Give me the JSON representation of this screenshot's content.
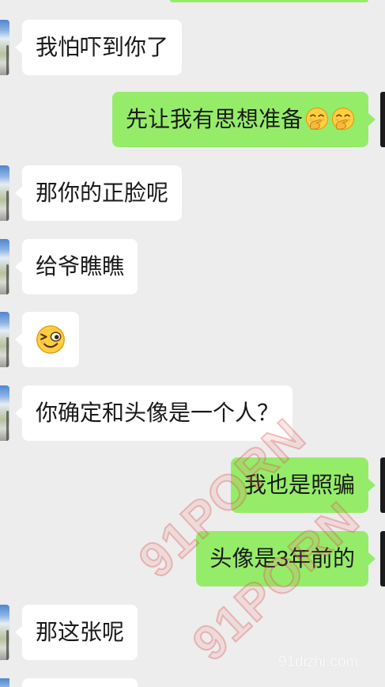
{
  "colors": {
    "background": "#ededed",
    "sent_bubble": "#95ec69",
    "received_bubble": "#ffffff"
  },
  "messages": [
    {
      "outgoing": false,
      "text": "我怕吓到你了"
    },
    {
      "outgoing": true,
      "text": "先让我有思想准备",
      "emoji": [
        "hand-over-mouth-emoji",
        "hand-over-mouth-emoji"
      ]
    },
    {
      "outgoing": false,
      "text": "那你的正脸呢"
    },
    {
      "outgoing": false,
      "text": "给爷瞧瞧"
    },
    {
      "outgoing": false,
      "emoji": [
        "wink-emoji"
      ]
    },
    {
      "outgoing": false,
      "text": "你确定和头像是一个人？"
    },
    {
      "outgoing": true,
      "text": "我也是照骗"
    },
    {
      "outgoing": true,
      "text": "头像是3年前的"
    },
    {
      "outgoing": false,
      "text": "那这张呢"
    }
  ],
  "watermark": {
    "repeated_text": [
      "91PORN",
      "91PORN"
    ],
    "site": "91dizhi.com"
  }
}
